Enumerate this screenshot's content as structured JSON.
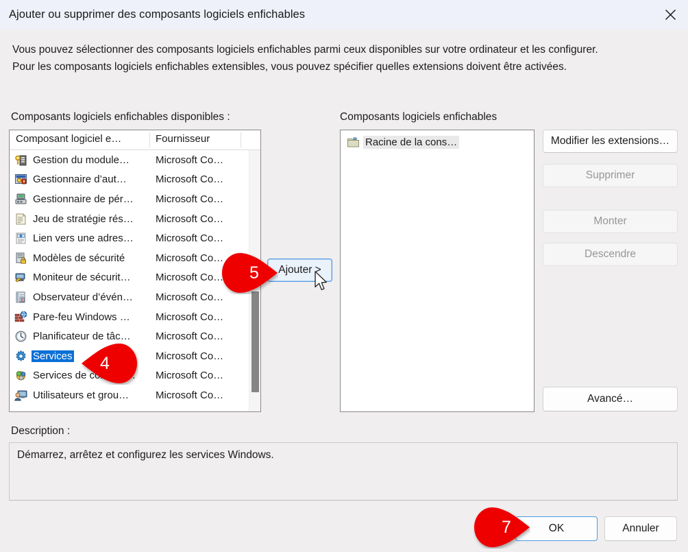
{
  "window": {
    "title": "Ajouter ou supprimer des composants logiciels enfichables",
    "close_icon": "close-icon"
  },
  "intro": {
    "line1": "Vous pouvez sélectionner des composants logiciels enfichables parmi ceux disponibles sur votre ordinateur et les configurer.",
    "line2": "Pour les composants logiciels enfichables extensibles, vous pouvez spécifier quelles extensions doivent être activées."
  },
  "labels": {
    "available": "Composants logiciels enfichables disponibles :",
    "selected": "Composants logiciels enfichables",
    "description": "Description :"
  },
  "available_list": {
    "columns": [
      "Composant logiciel e…",
      "Fournisseur"
    ],
    "rows": [
      {
        "name": "Gestion du module…",
        "vendor": "Microsoft Co…",
        "icon": "key-module-icon",
        "selected": false
      },
      {
        "name": "Gestionnaire d’aut…",
        "vendor": "Microsoft Co…",
        "icon": "auth-manager-icon",
        "selected": false
      },
      {
        "name": "Gestionnaire de pér…",
        "vendor": "Microsoft Co…",
        "icon": "device-manager-icon",
        "selected": false
      },
      {
        "name": "Jeu de stratégie rés…",
        "vendor": "Microsoft Co…",
        "icon": "policy-scroll-icon",
        "selected": false
      },
      {
        "name": "Lien vers une adres…",
        "vendor": "Microsoft Co…",
        "icon": "web-link-icon",
        "selected": false
      },
      {
        "name": "Modèles de sécurité",
        "vendor": "Microsoft Co…",
        "icon": "security-template-icon",
        "selected": false
      },
      {
        "name": "Moniteur de sécurit…",
        "vendor": "Microsoft Co…",
        "icon": "security-monitor-icon",
        "selected": false
      },
      {
        "name": "Observateur d’évén…",
        "vendor": "Microsoft Co…",
        "icon": "event-viewer-icon",
        "selected": false
      },
      {
        "name": "Pare-feu Windows …",
        "vendor": "Microsoft Co…",
        "icon": "firewall-icon",
        "selected": false
      },
      {
        "name": "Planificateur de tâc…",
        "vendor": "Microsoft Co…",
        "icon": "task-scheduler-icon",
        "selected": false
      },
      {
        "name": "Services",
        "vendor": "Microsoft Co…",
        "icon": "services-gear-icon",
        "selected": true
      },
      {
        "name": "Services de compos…",
        "vendor": "Microsoft Co…",
        "icon": "component-services-icon",
        "selected": false
      },
      {
        "name": "Utilisateurs et grou…",
        "vendor": "Microsoft Co…",
        "icon": "users-groups-icon",
        "selected": false
      }
    ]
  },
  "selected_list": {
    "rows": [
      {
        "name": "Racine de la cons…",
        "icon": "folder-icon",
        "selected": true
      }
    ]
  },
  "buttons": {
    "add": "Ajouter >",
    "modify_extensions": "Modifier les extensions…",
    "remove": "Supprimer",
    "move_up": "Monter",
    "move_down": "Descendre",
    "advanced": "Avancé…",
    "ok": "OK",
    "cancel": "Annuler"
  },
  "description": {
    "text": "Démarrez, arrêtez et configurez les services Windows."
  },
  "callouts": [
    {
      "id": "callout-5",
      "number": "5"
    },
    {
      "id": "callout-4",
      "number": "4"
    },
    {
      "id": "callout-7",
      "number": "7"
    }
  ],
  "colors": {
    "titlebar": "#eef1f9",
    "dialog_bg": "#f0eeee",
    "selection_blue": "#0b6fd6",
    "callout_red": "#ee0000",
    "focus_blue": "#4f9ae0"
  }
}
